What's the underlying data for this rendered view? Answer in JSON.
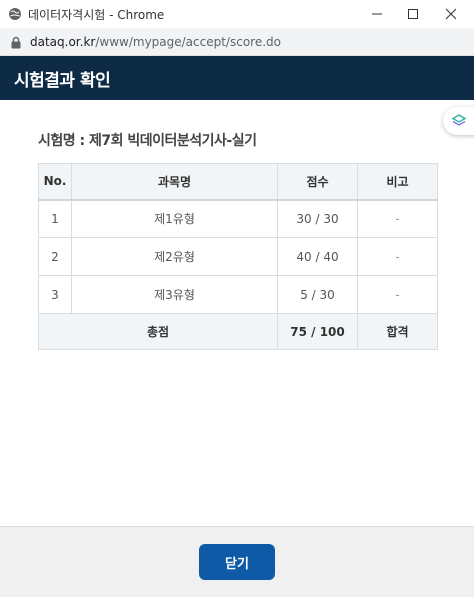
{
  "window": {
    "title": "데이터자격시험 - Chrome",
    "url_host": "dataq.or.kr",
    "url_path": "/www/mypage/accept/score.do"
  },
  "header": {
    "title": "시험결과 확인"
  },
  "exam": {
    "name": "시험명 : 제7회 빅데이터분석기사-실기"
  },
  "table": {
    "columns": [
      "No.",
      "과목명",
      "점수",
      "비고"
    ],
    "rows": [
      {
        "no": "1",
        "subject": "제1유형",
        "score": "30 / 30",
        "note": "-"
      },
      {
        "no": "2",
        "subject": "제2유형",
        "score": "40 / 40",
        "note": "-"
      },
      {
        "no": "3",
        "subject": "제3유형",
        "score": "5 / 30",
        "note": "-"
      }
    ],
    "total": {
      "label": "총점",
      "score": "75 / 100",
      "result": "합격"
    }
  },
  "footer": {
    "close_label": "닫기"
  },
  "colors": {
    "header_bg": "#0d2b45",
    "button_bg": "#0e5aa7",
    "table_header_bg": "#f2f5f7"
  }
}
